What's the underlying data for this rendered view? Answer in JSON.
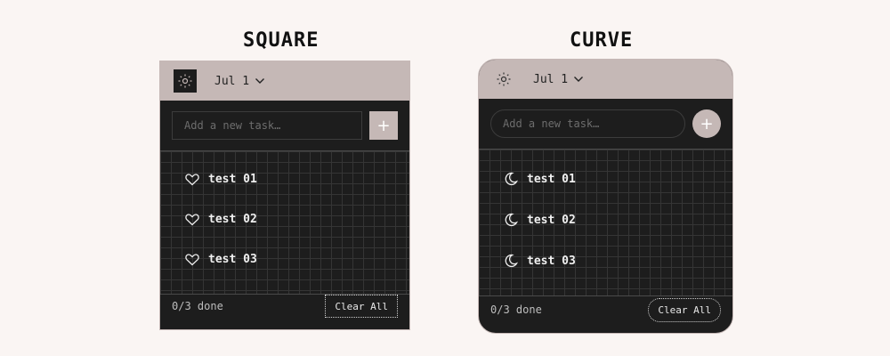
{
  "square": {
    "title": "SQUARE",
    "date": "Jul 1",
    "placeholder": "Add a new task…",
    "add_label": "+",
    "tasks": [
      {
        "label": "test 01",
        "icon": "heart-icon"
      },
      {
        "label": "test 02",
        "icon": "heart-icon"
      },
      {
        "label": "test 03",
        "icon": "heart-icon"
      }
    ],
    "done": "0/3 done",
    "clear_label": "Clear All"
  },
  "curve": {
    "title": "CURVE",
    "date": "Jul 1",
    "placeholder": "Add a new task…",
    "add_label": "+",
    "tasks": [
      {
        "label": "test 01",
        "icon": "moon-icon"
      },
      {
        "label": "test 02",
        "icon": "moon-icon"
      },
      {
        "label": "test 03",
        "icon": "moon-icon"
      }
    ],
    "done": "0/3 done",
    "clear_label": "Clear All"
  },
  "colors": {
    "page_bg": "#faf5f3",
    "header": "#c5b8b6",
    "panel": "#1d1d1d",
    "text": "#f0f0f0"
  }
}
